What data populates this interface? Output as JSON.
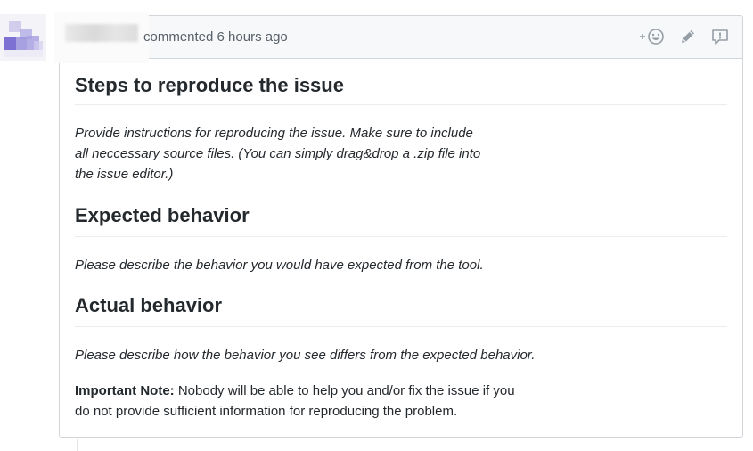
{
  "comment": {
    "author": "",
    "meta_text": "commented 6 hours ago",
    "actions": {
      "reaction_icon": "add-reaction-icon",
      "edit_icon": "pencil-icon",
      "report_icon": "report-content-icon"
    }
  },
  "body": {
    "section1": {
      "heading": "Steps to reproduce the issue",
      "line1": "Provide instructions for reproducing the issue. Make sure to include",
      "line2": "all neccessary source files. (You can simply drag&drop a .zip file into",
      "line3": "the issue editor.)"
    },
    "section2": {
      "heading": "Expected behavior",
      "line1": "Please describe the behavior you would have expected from the tool."
    },
    "section3": {
      "heading": "Actual behavior",
      "line1": "Please describe how the behavior you see differs from the expected behavior."
    },
    "note": {
      "label": "Important Note:",
      "line1": " Nobody will be able to help you and/or fix the issue if you",
      "line2": "do not provide sufficient information for reproducing the problem."
    }
  },
  "colors": {
    "header_bg": "#f6f8fa",
    "border": "#d1d5da",
    "meta_text": "#586069",
    "icon": "#959da5",
    "avatar_primary": "#6a5acd"
  }
}
